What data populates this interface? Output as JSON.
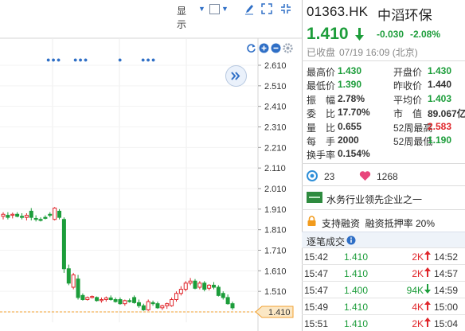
{
  "toolbar": {
    "display_label": "显示",
    "display_arrow": "▼",
    "checkbox_arrow": "▼"
  },
  "chart_data": {
    "type": "candlestick",
    "y_ticks": [
      "2.610",
      "2.510",
      "2.410",
      "2.310",
      "2.210",
      "2.110",
      "2.010",
      "1.910",
      "1.810",
      "1.710",
      "1.610",
      "1.510",
      "1.410"
    ],
    "ylim": [
      1.38,
      2.64
    ],
    "current_price_label": "1.410",
    "candles": [
      {
        "o": 1.875,
        "h": 1.895,
        "l": 1.86,
        "c": 1.885
      },
      {
        "o": 1.88,
        "h": 1.895,
        "l": 1.86,
        "c": 1.87
      },
      {
        "o": 1.88,
        "h": 1.893,
        "l": 1.865,
        "c": 1.885
      },
      {
        "o": 1.885,
        "h": 1.895,
        "l": 1.87,
        "c": 1.875
      },
      {
        "o": 1.875,
        "h": 1.89,
        "l": 1.86,
        "c": 1.87
      },
      {
        "o": 1.87,
        "h": 1.89,
        "l": 1.855,
        "c": 1.88
      },
      {
        "o": 1.9,
        "h": 1.915,
        "l": 1.855,
        "c": 1.87
      },
      {
        "o": 1.865,
        "h": 1.88,
        "l": 1.85,
        "c": 1.86
      },
      {
        "o": 1.86,
        "h": 1.87,
        "l": 1.85,
        "c": 1.855
      },
      {
        "o": 1.87,
        "h": 1.88,
        "l": 1.86,
        "c": 1.865
      },
      {
        "o": 1.885,
        "h": 1.895,
        "l": 1.87,
        "c": 1.88
      },
      {
        "o": 1.86,
        "h": 1.92,
        "l": 1.855,
        "c": 1.915
      },
      {
        "o": 1.9,
        "h": 1.91,
        "l": 1.86,
        "c": 1.87
      },
      {
        "o": 1.86,
        "h": 1.87,
        "l": 1.6,
        "c": 1.62
      },
      {
        "o": 1.62,
        "h": 1.64,
        "l": 1.54,
        "c": 1.55
      },
      {
        "o": 1.53,
        "h": 1.6,
        "l": 1.52,
        "c": 1.59
      },
      {
        "o": 1.57,
        "h": 1.59,
        "l": 1.47,
        "c": 1.48
      },
      {
        "o": 1.49,
        "h": 1.5,
        "l": 1.465,
        "c": 1.47
      },
      {
        "o": 1.47,
        "h": 1.485,
        "l": 1.465,
        "c": 1.48
      },
      {
        "o": 1.48,
        "h": 1.49,
        "l": 1.475,
        "c": 1.485
      },
      {
        "o": 1.48,
        "h": 1.485,
        "l": 1.46,
        "c": 1.465
      },
      {
        "o": 1.465,
        "h": 1.48,
        "l": 1.455,
        "c": 1.47
      },
      {
        "o": 1.47,
        "h": 1.485,
        "l": 1.46,
        "c": 1.478
      },
      {
        "o": 1.478,
        "h": 1.49,
        "l": 1.465,
        "c": 1.47
      },
      {
        "o": 1.47,
        "h": 1.48,
        "l": 1.455,
        "c": 1.46
      },
      {
        "o": 1.47,
        "h": 1.48,
        "l": 1.445,
        "c": 1.45
      },
      {
        "o": 1.45,
        "h": 1.47,
        "l": 1.44,
        "c": 1.465
      },
      {
        "o": 1.465,
        "h": 1.475,
        "l": 1.455,
        "c": 1.46
      },
      {
        "o": 1.48,
        "h": 1.49,
        "l": 1.45,
        "c": 1.455
      },
      {
        "o": 1.455,
        "h": 1.47,
        "l": 1.43,
        "c": 1.44
      },
      {
        "o": 1.44,
        "h": 1.45,
        "l": 1.415,
        "c": 1.42
      },
      {
        "o": 1.42,
        "h": 1.47,
        "l": 1.415,
        "c": 1.46
      },
      {
        "o": 1.455,
        "h": 1.465,
        "l": 1.44,
        "c": 1.45
      },
      {
        "o": 1.45,
        "h": 1.46,
        "l": 1.425,
        "c": 1.43
      },
      {
        "o": 1.43,
        "h": 1.445,
        "l": 1.42,
        "c": 1.44
      },
      {
        "o": 1.44,
        "h": 1.455,
        "l": 1.425,
        "c": 1.45
      },
      {
        "o": 1.44,
        "h": 1.48,
        "l": 1.435,
        "c": 1.47
      },
      {
        "o": 1.47,
        "h": 1.51,
        "l": 1.46,
        "c": 1.5
      },
      {
        "o": 1.5,
        "h": 1.535,
        "l": 1.49,
        "c": 1.52
      },
      {
        "o": 1.52,
        "h": 1.56,
        "l": 1.51,
        "c": 1.55
      },
      {
        "o": 1.55,
        "h": 1.575,
        "l": 1.54,
        "c": 1.56
      },
      {
        "o": 1.56,
        "h": 1.57,
        "l": 1.52,
        "c": 1.525
      },
      {
        "o": 1.53,
        "h": 1.56,
        "l": 1.52,
        "c": 1.55
      },
      {
        "o": 1.55,
        "h": 1.56,
        "l": 1.51,
        "c": 1.52
      },
      {
        "o": 1.525,
        "h": 1.545,
        "l": 1.515,
        "c": 1.54
      },
      {
        "o": 1.54,
        "h": 1.555,
        "l": 1.52,
        "c": 1.53
      },
      {
        "o": 1.53,
        "h": 1.54,
        "l": 1.485,
        "c": 1.49
      },
      {
        "o": 1.5,
        "h": 1.51,
        "l": 1.47,
        "c": 1.48
      },
      {
        "o": 1.48,
        "h": 1.495,
        "l": 1.445,
        "c": 1.45
      },
      {
        "o": 1.45,
        "h": 1.46,
        "l": 1.42,
        "c": 1.43
      }
    ],
    "up_color": "#e0262b",
    "down_color": "#1c9d3a"
  },
  "quote": {
    "symbol": "01363.HK",
    "name": "中滔环保",
    "price": "1.410",
    "change": "-0.030",
    "change_pct": "-2.08%",
    "status": "已收盘",
    "timestamp": "07/19 16:09 (北京)",
    "stats": [
      {
        "l1": "最高价",
        "v1": "1.430",
        "c1": "grn",
        "l2": "开盘价",
        "v2": "1.430",
        "c2": "grn"
      },
      {
        "l1": "最低价",
        "v1": "1.390",
        "c1": "grn",
        "l2": "昨收价",
        "v2": "1.440",
        "c2": ""
      },
      {
        "l1": "振　幅",
        "v1": "2.78%",
        "c1": "",
        "l2": "平均价",
        "v2": "1.403",
        "c2": "grn"
      },
      {
        "l1": "委　比",
        "v1": "17.70%",
        "c1": "",
        "l2": "市　值",
        "v2": "89.067亿",
        "c2": ""
      },
      {
        "l1": "量　比",
        "v1": "0.655",
        "c1": "",
        "l2": "52周最高",
        "v2": "2.583",
        "c2": "red"
      },
      {
        "l1": "每　手",
        "v1": "2000",
        "c1": "",
        "l2": "52周最低",
        "v2": "1.190",
        "c2": "grn"
      },
      {
        "l1": "换手率",
        "v1": "0.154%",
        "c1": "",
        "l2": "",
        "v2": "",
        "c2": ""
      }
    ],
    "watchers": "23",
    "likes": "1268",
    "industry_text": "水务行业领先企业之一",
    "margin_text": "支持融资  融资抵押率 20%",
    "trades_header": "逐笔成交",
    "trades": [
      {
        "t": "15:42",
        "p": "1.410",
        "v": "2K",
        "dir": "up",
        "t2": "14:52"
      },
      {
        "t": "15:47",
        "p": "1.410",
        "v": "2K",
        "dir": "up",
        "t2": "14:57"
      },
      {
        "t": "15:47",
        "p": "1.400",
        "v": "94K",
        "dir": "down",
        "t2": "14:59"
      },
      {
        "t": "15:49",
        "p": "1.410",
        "v": "4K",
        "dir": "up",
        "t2": "15:00"
      },
      {
        "t": "15:51",
        "p": "1.410",
        "v": "2K",
        "dir": "up",
        "t2": "15:04"
      }
    ]
  }
}
